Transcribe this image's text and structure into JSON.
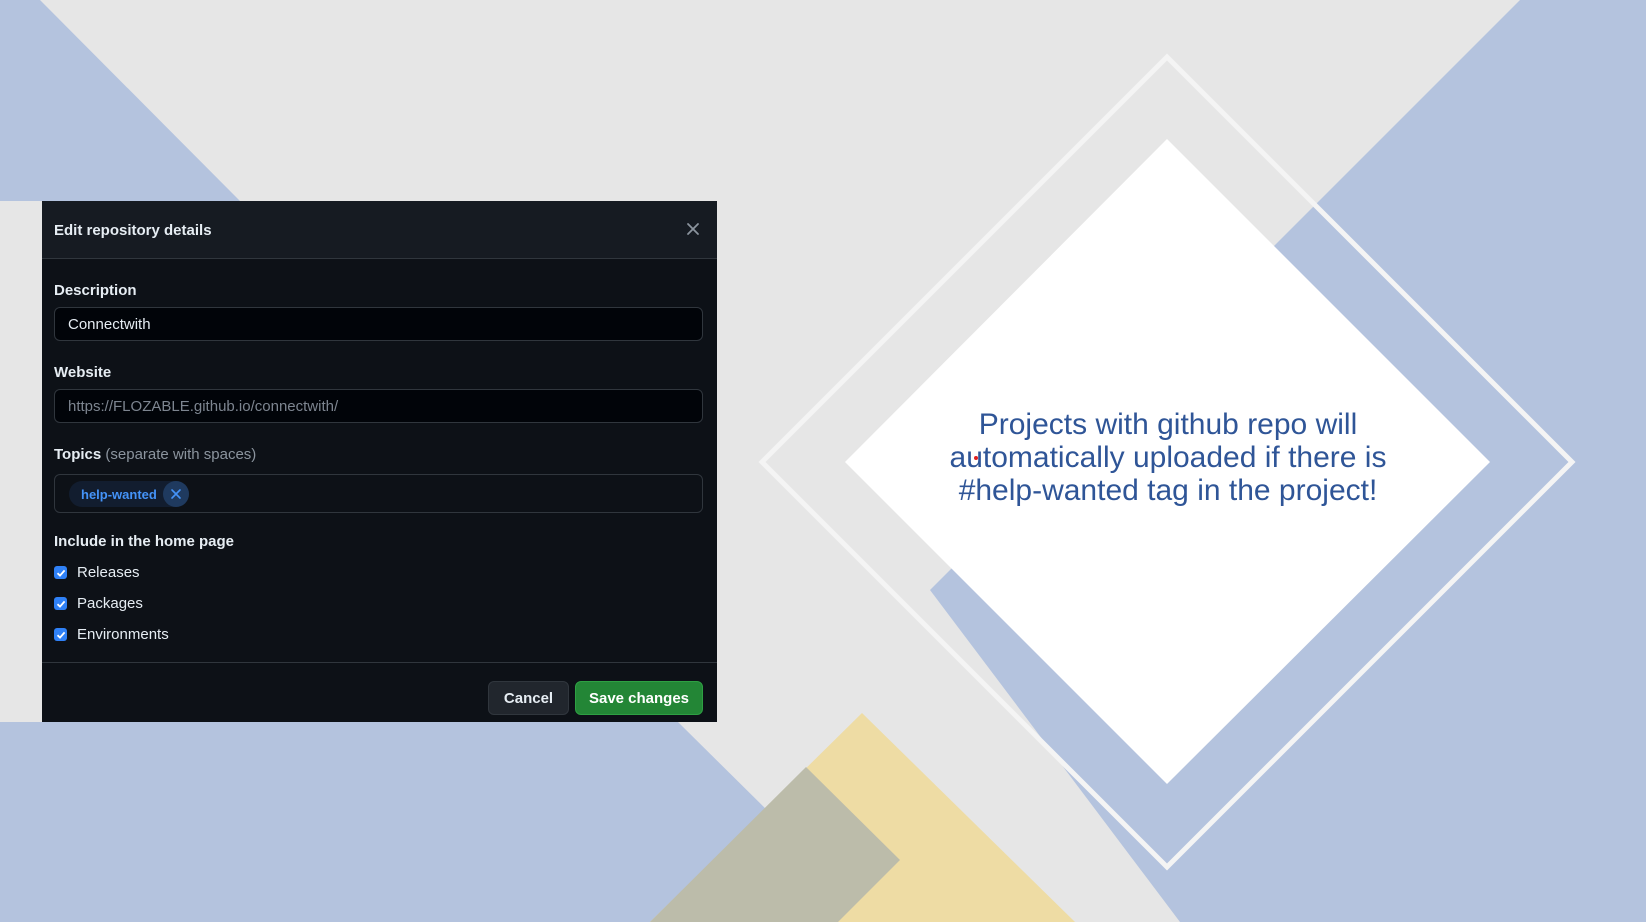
{
  "slide": {
    "text_line1": "Projects with github repo will",
    "text_line2": "automatically uploaded if there is",
    "text_line3": "#help-wanted tag in the project!",
    "colors": {
      "accent_blue": "#b4c3de",
      "accent_yellow": "#eedca4",
      "background": "#e6e6e6",
      "text": "#2f5597"
    }
  },
  "dialog": {
    "title": "Edit repository details",
    "close_icon": "close-icon",
    "description": {
      "label": "Description",
      "value": "Connectwith"
    },
    "website": {
      "label": "Website",
      "placeholder": "https://FLOZABLE.github.io/connectwith/"
    },
    "topics": {
      "label": "Topics",
      "hint": "(separate with spaces)",
      "tags": [
        "help-wanted"
      ]
    },
    "home_page": {
      "label": "Include in the home page",
      "options": [
        {
          "label": "Releases",
          "checked": true
        },
        {
          "label": "Packages",
          "checked": true
        },
        {
          "label": "Environments",
          "checked": true
        }
      ]
    },
    "footer": {
      "cancel_label": "Cancel",
      "save_label": "Save changes"
    },
    "colors": {
      "bg": "#0d1117",
      "header_bg": "#161b22",
      "primary": "#238636",
      "link": "#4493f8"
    }
  }
}
